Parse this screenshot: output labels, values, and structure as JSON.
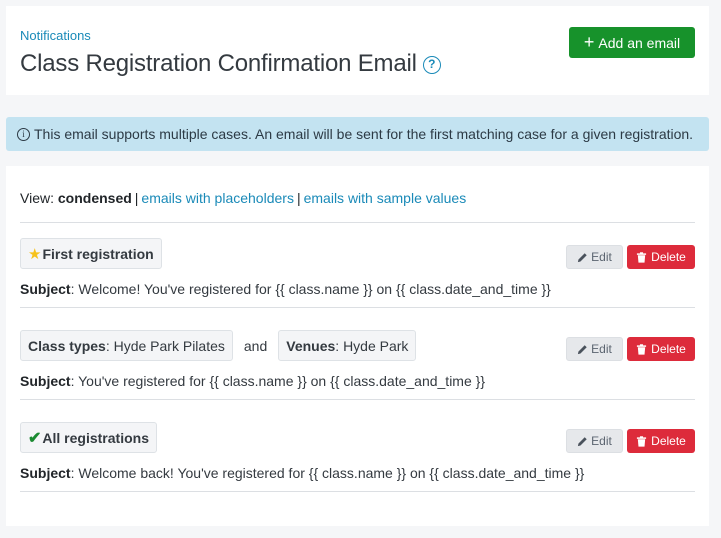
{
  "header": {
    "breadcrumb": "Notifications",
    "title": "Class Registration Confirmation Email",
    "help_icon": "question-circle-icon",
    "add_button": {
      "icon": "plus-icon",
      "label": "Add an email"
    }
  },
  "alert": {
    "icon": "info-circle-icon",
    "text": "This email supports multiple cases. An email will be sent for the first matching case for a given registration."
  },
  "view": {
    "prefix": "View:",
    "current": "condensed",
    "separator": "|",
    "options": [
      "emails with placeholders",
      "emails with sample values"
    ]
  },
  "cases": [
    {
      "tags": [
        {
          "icon": "star-icon",
          "label": "First registration"
        }
      ],
      "subject_label": "Subject",
      "subject": "Welcome! You've registered for {{ class.name }} on {{ class.date_and_time }}",
      "edit_label": "Edit",
      "delete_label": "Delete"
    },
    {
      "tags": [
        {
          "key": "Class types",
          "value": "Hyde Park Pilates"
        },
        {
          "key": "Venues",
          "value": "Hyde Park"
        }
      ],
      "conjunction": "and",
      "subject_label": "Subject",
      "subject": "You've registered for {{ class.name }} on {{ class.date_and_time }}",
      "edit_label": "Edit",
      "delete_label": "Delete"
    },
    {
      "tags": [
        {
          "icon": "check-icon",
          "label": "All registrations"
        }
      ],
      "subject_label": "Subject",
      "subject": "Welcome back! You've registered for {{ class.name }} on {{ class.date_and_time }}",
      "edit_label": "Edit",
      "delete_label": "Delete"
    }
  ],
  "colors": {
    "link": "#1a8ab8",
    "primary_green": "#17922b",
    "danger_red": "#dd2b3b",
    "alert_bg": "#c3e3f1",
    "star": "#f6c21b",
    "check": "#1b8a31"
  }
}
